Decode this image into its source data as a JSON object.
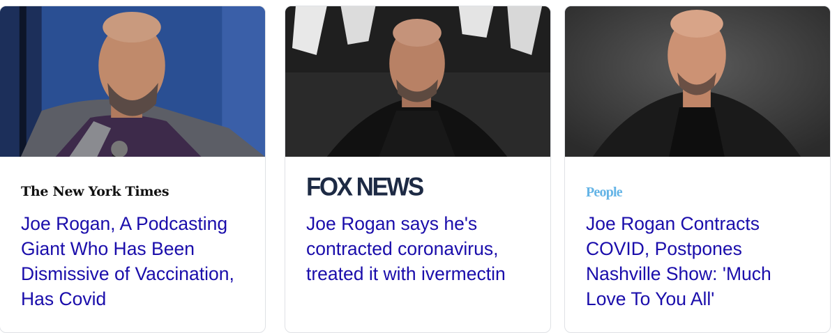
{
  "cards": [
    {
      "source": "The New York Times",
      "headline": "Joe Rogan, A Podcasting Giant Who Has Been Dismissive of Vaccination, Has Covid"
    },
    {
      "source": "FOX NEWS",
      "headline": "Joe Rogan says he's contracted coronavirus, treated it with ivermectin"
    },
    {
      "source": "People",
      "headline": "Joe Rogan Contracts COVID, Postpones Nashville Show: 'Much Love To You All'"
    }
  ],
  "colors": {
    "headline_link": "#1a0dab",
    "card_border": "#dfe1e5",
    "fox_logo": "#1d2a44",
    "people_logo": "#64b4e6"
  }
}
